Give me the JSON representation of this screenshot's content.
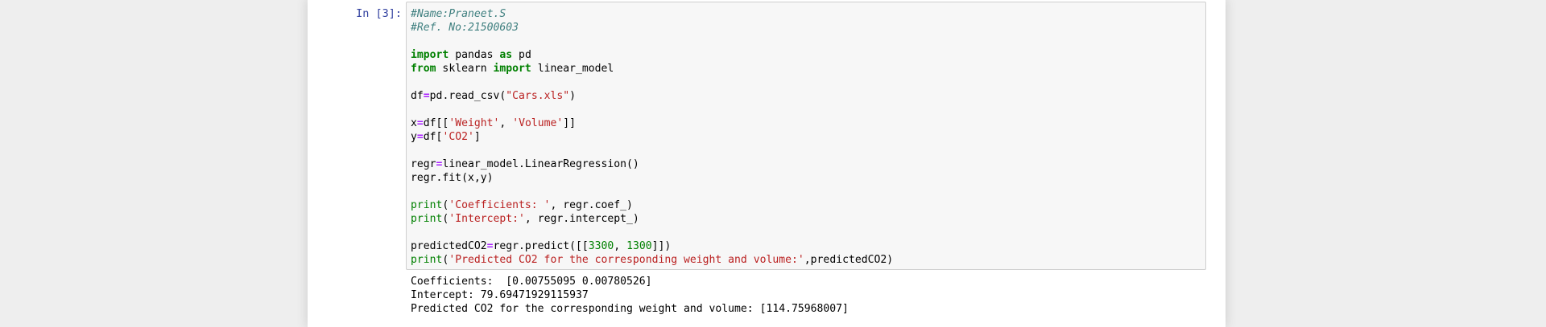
{
  "cell": {
    "prompt": "In [3]:",
    "code": [
      [
        {
          "t": "#Name:Praneet.S",
          "c": "comment"
        }
      ],
      [
        {
          "t": "#Ref. No:21500603",
          "c": "comment"
        }
      ],
      [],
      [
        {
          "t": "import",
          "c": "keyword"
        },
        {
          "t": " pandas ",
          "c": ""
        },
        {
          "t": "as",
          "c": "keyword"
        },
        {
          "t": " pd",
          "c": ""
        }
      ],
      [
        {
          "t": "from",
          "c": "keyword"
        },
        {
          "t": " sklearn ",
          "c": ""
        },
        {
          "t": "import",
          "c": "keyword"
        },
        {
          "t": " linear_model",
          "c": ""
        }
      ],
      [],
      [
        {
          "t": "df",
          "c": ""
        },
        {
          "t": "=",
          "c": "operator"
        },
        {
          "t": "pd.read_csv(",
          "c": ""
        },
        {
          "t": "\"Cars.xls\"",
          "c": "string"
        },
        {
          "t": ")",
          "c": ""
        }
      ],
      [],
      [
        {
          "t": "x",
          "c": ""
        },
        {
          "t": "=",
          "c": "operator"
        },
        {
          "t": "df[[",
          "c": ""
        },
        {
          "t": "'Weight'",
          "c": "string"
        },
        {
          "t": ", ",
          "c": ""
        },
        {
          "t": "'Volume'",
          "c": "string"
        },
        {
          "t": "]]",
          "c": ""
        }
      ],
      [
        {
          "t": "y",
          "c": ""
        },
        {
          "t": "=",
          "c": "operator"
        },
        {
          "t": "df[",
          "c": ""
        },
        {
          "t": "'CO2'",
          "c": "string"
        },
        {
          "t": "]",
          "c": ""
        }
      ],
      [],
      [
        {
          "t": "regr",
          "c": ""
        },
        {
          "t": "=",
          "c": "operator"
        },
        {
          "t": "linear_model.LinearRegression()",
          "c": ""
        }
      ],
      [
        {
          "t": "regr.fit(x,y)",
          "c": ""
        }
      ],
      [],
      [
        {
          "t": "print",
          "c": "builtin"
        },
        {
          "t": "(",
          "c": ""
        },
        {
          "t": "'Coefficients: '",
          "c": "string"
        },
        {
          "t": ", regr.coef_)",
          "c": ""
        }
      ],
      [
        {
          "t": "print",
          "c": "builtin"
        },
        {
          "t": "(",
          "c": ""
        },
        {
          "t": "'Intercept:'",
          "c": "string"
        },
        {
          "t": ", regr.intercept_)",
          "c": ""
        }
      ],
      [],
      [
        {
          "t": "predictedCO2",
          "c": ""
        },
        {
          "t": "=",
          "c": "operator"
        },
        {
          "t": "regr.predict([[",
          "c": ""
        },
        {
          "t": "3300",
          "c": "number"
        },
        {
          "t": ", ",
          "c": ""
        },
        {
          "t": "1300",
          "c": "number"
        },
        {
          "t": "]])",
          "c": ""
        }
      ],
      [
        {
          "t": "print",
          "c": "builtin"
        },
        {
          "t": "(",
          "c": ""
        },
        {
          "t": "'Predicted CO2 for the corresponding weight and volume:'",
          "c": "string"
        },
        {
          "t": ",predictedCO2)",
          "c": ""
        }
      ]
    ],
    "output": [
      "Coefficients:  [0.00755095 0.00780526]",
      "Intercept: 79.69471929115937",
      "Predicted CO2 for the corresponding weight and volume: [114.75968007]"
    ]
  }
}
